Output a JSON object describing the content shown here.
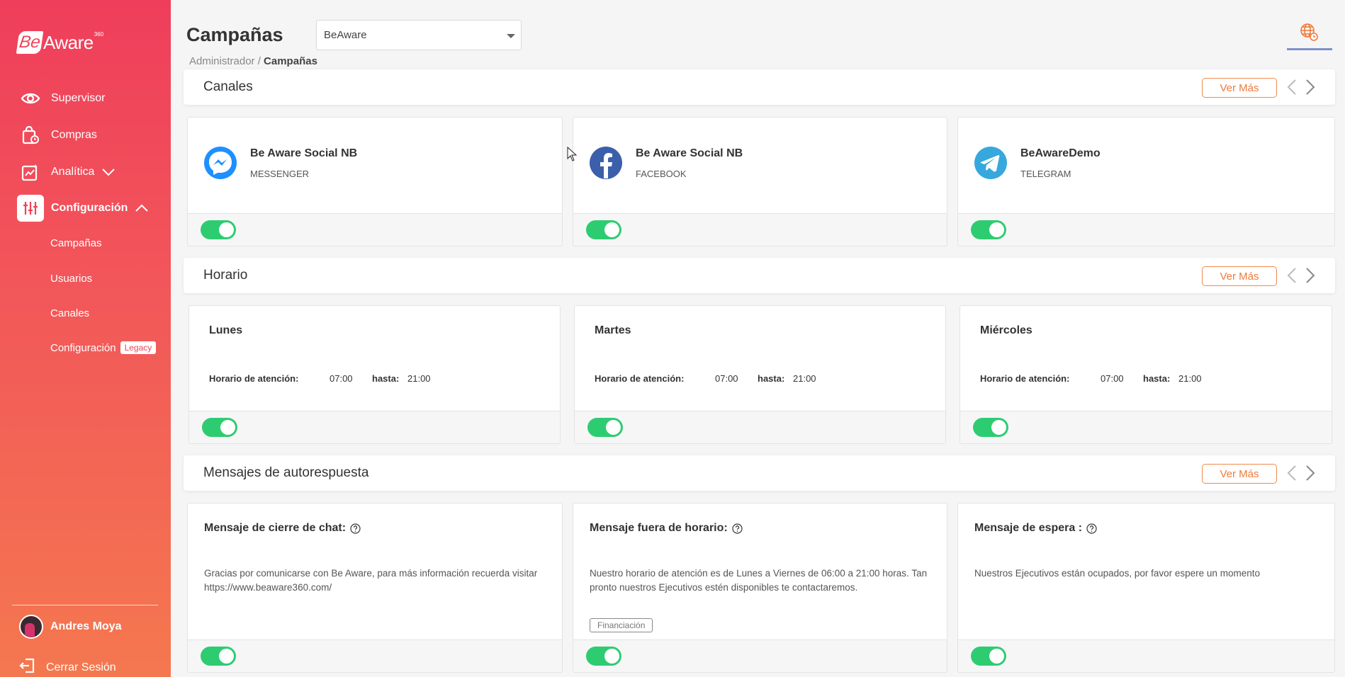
{
  "app": {
    "logo_be": "Be",
    "logo_aware": "Aware",
    "logo_360": "360",
    "brand_colors": {
      "primary": "#ef3e5b",
      "secondary": "#f4784f",
      "toggle_on": "#2ecc71",
      "accent_button": "#f07a3a"
    }
  },
  "sidebar": {
    "items": [
      {
        "label": "Supervisor",
        "icon": "eye-icon"
      },
      {
        "label": "Compras",
        "icon": "shopping-bag-icon"
      },
      {
        "label": "Analítica",
        "icon": "analytics-icon"
      },
      {
        "label": "Configuración",
        "icon": "sliders-icon"
      }
    ],
    "subitems": [
      {
        "label": "Campañas"
      },
      {
        "label": "Usuarios"
      },
      {
        "label": "Canales"
      },
      {
        "label": "Configuración",
        "badge": "Legacy"
      }
    ],
    "user": {
      "name": "Andres Moya"
    },
    "logout_label": "Cerrar Sesión"
  },
  "header": {
    "title": "Campañas",
    "campaign_select": {
      "value": "BeAware"
    },
    "breadcrumb": {
      "parent": "Administrador /",
      "current": "Campañas"
    }
  },
  "sections": {
    "canales": {
      "title": "Canales",
      "ver_mas": "Ver Más",
      "cards": [
        {
          "name": "Be Aware Social NB",
          "type": "MESSENGER",
          "icon": "messenger-icon",
          "enabled": true
        },
        {
          "name": "Be Aware Social NB",
          "type": "FACEBOOK",
          "icon": "facebook-icon",
          "enabled": true
        },
        {
          "name": "BeAwareDemo",
          "type": "TELEGRAM",
          "icon": "telegram-icon",
          "enabled": true
        }
      ]
    },
    "horario": {
      "title": "Horario",
      "ver_mas": "Ver Más",
      "label_atencion": "Horario de atención:",
      "label_hasta": "hasta:",
      "cards": [
        {
          "day": "Lunes",
          "from": "07:00",
          "to": "21:00",
          "enabled": true
        },
        {
          "day": "Martes",
          "from": "07:00",
          "to": "21:00",
          "enabled": true
        },
        {
          "day": "Miércoles",
          "from": "07:00",
          "to": "21:00",
          "enabled": true
        }
      ]
    },
    "mensajes": {
      "title": "Mensajes de autorespuesta",
      "ver_mas": "Ver Más",
      "cards": [
        {
          "title": "Mensaje de cierre de chat:",
          "text": "Gracias por comunicarse con Be Aware, para más información recuerda visitar https://www.beaware360.com/",
          "enabled": true
        },
        {
          "title": "Mensaje fuera de horario:",
          "text": "Nuestro horario de atención es de Lunes a Viernes de 06:00 a 21:00 horas. Tan pronto nuestros Ejecutivos estén disponibles te contactaremos.",
          "tag": "Financiación",
          "enabled": true
        },
        {
          "title": "Mensaje de espera :",
          "text": "Nuestros Ejecutivos están ocupados, por favor espere un momento",
          "enabled": true
        }
      ]
    }
  }
}
